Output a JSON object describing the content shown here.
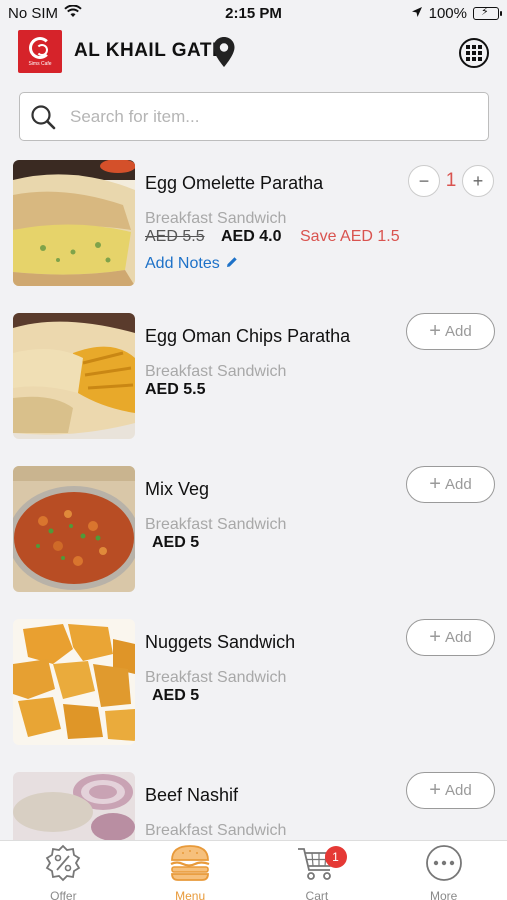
{
  "status_bar": {
    "carrier": "No SIM",
    "time": "2:15 PM",
    "battery": "100%"
  },
  "header": {
    "logo_text": "Sims Cafe",
    "store_name": "AL KHAIL GATE",
    "icons": [
      "location-pin-icon",
      "grid-menu-icon"
    ]
  },
  "search": {
    "placeholder": "Search for item..."
  },
  "items": [
    {
      "name": "Egg Omelette Paratha",
      "category": "Breakfast Sandwich",
      "old_price": "AED 5.5",
      "price": "AED 4.0",
      "save": "Save AED 1.5",
      "notes_label": "Add Notes",
      "quantity": "1",
      "minus": "−",
      "plus": "+"
    },
    {
      "name": "Egg Oman Chips Paratha",
      "category": "Breakfast Sandwich",
      "price": "AED 5.5",
      "add_label": "Add"
    },
    {
      "name": "Mix Veg",
      "category": "Breakfast Sandwich",
      "price": "AED 5",
      "add_label": "Add"
    },
    {
      "name": "Nuggets Sandwich",
      "category": "Breakfast Sandwich",
      "price": "AED 5",
      "add_label": "Add"
    },
    {
      "name": "Beef Nashif",
      "category": "Breakfast Sandwich",
      "add_label": "Add"
    }
  ],
  "tabbar": {
    "tabs": [
      {
        "label": "Offer",
        "icon": "offer-percent-icon"
      },
      {
        "label": "Menu",
        "icon": "burger-icon"
      },
      {
        "label": "Cart",
        "icon": "cart-icon",
        "badge": "1"
      },
      {
        "label": "More",
        "icon": "more-dots-icon"
      }
    ],
    "active": "Menu"
  },
  "colors": {
    "accent": "#e89a3a",
    "save_red": "#d9534f",
    "link_blue": "#1e72c8",
    "logo_red": "#d6232a",
    "badge_red": "#e53935"
  }
}
